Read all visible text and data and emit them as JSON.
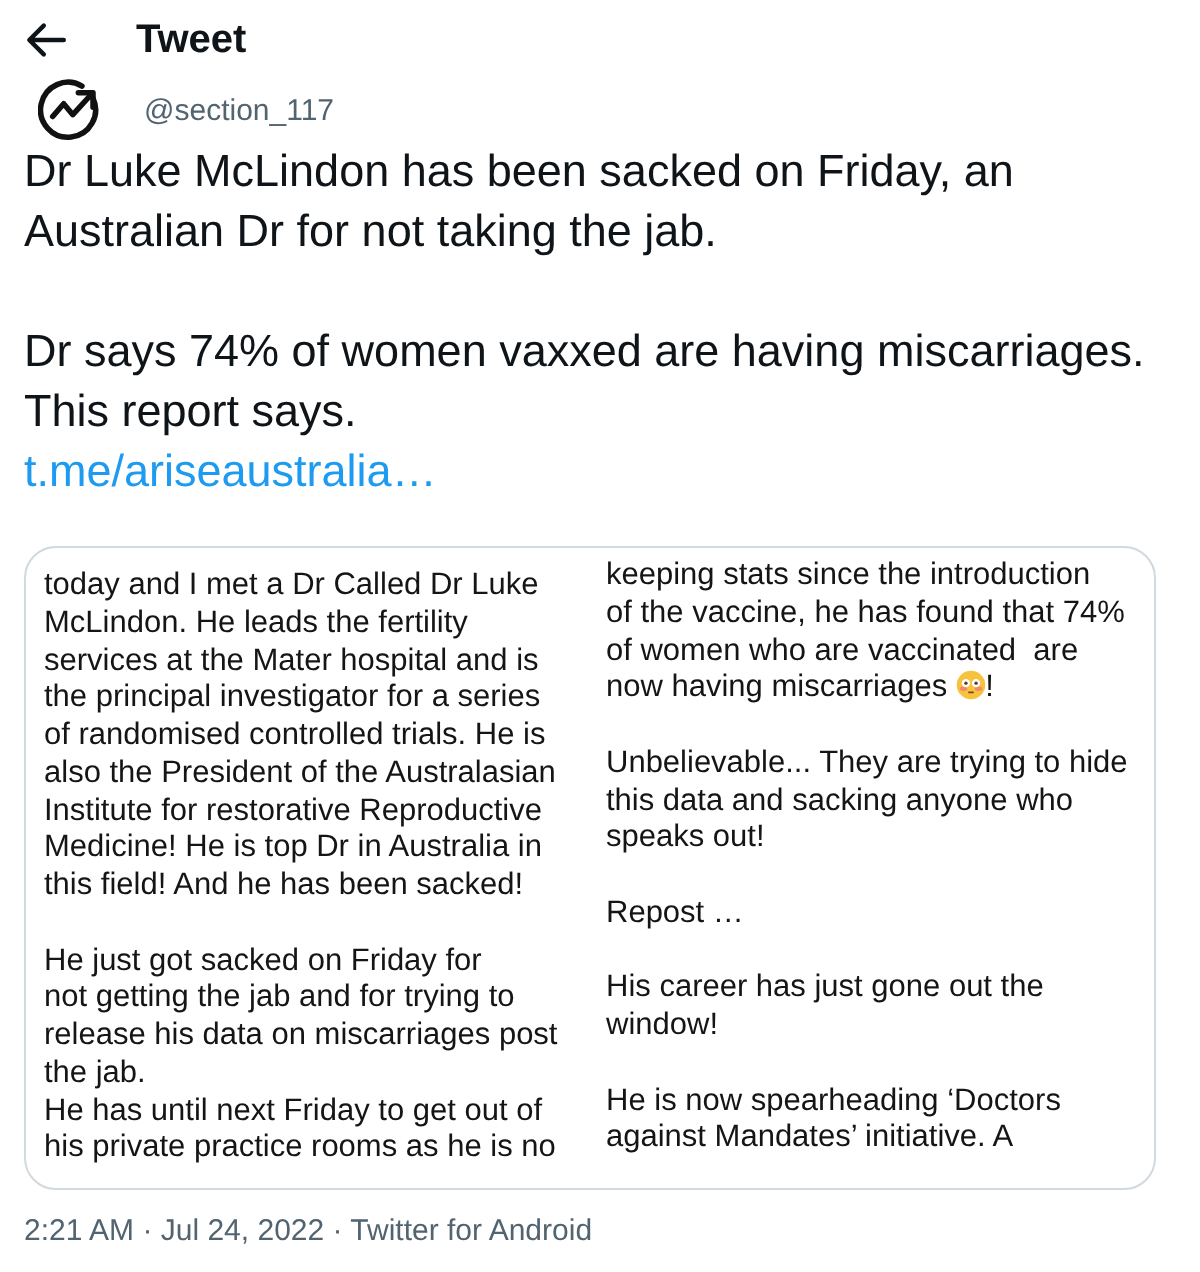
{
  "header": {
    "title": "Tweet"
  },
  "author": {
    "handle": "@section_117"
  },
  "tweet": {
    "paragraphs": [
      "Dr Luke McLindon has been sacked on Friday, an Australian Dr for not taking the jab.",
      "Dr says 74% of women vaxxed are having miscarriages.\nThis report says."
    ],
    "link": "t.me/ariseaustralia…"
  },
  "media": {
    "columns": [
      {
        "paragraphs": [
          {
            "parts": [
              {
                "kind": "block",
                "text": "today and I met a Dr Called Dr Luke\nMcLindon. He leads the fertility\nservices at the Mater hospital and is\nthe principal investigator for a series\nof randomised controlled trials. He is\nalso the President of the Australasian\nInstitute for restorative Reproductive\nMedicine! He is top Dr in Australia in\nthis field! And he has been sacked!"
              }
            ]
          },
          {
            "parts": [
              {
                "kind": "block",
                "text": "He just got sacked on Friday for\nnot getting the jab and for trying to\nrelease his data on miscarriages post\nthe jab.\nHe has until next Friday to get out of\nhis private practice rooms as he is no"
              }
            ]
          }
        ]
      },
      {
        "paragraphs": [
          {
            "parts": [
              {
                "kind": "block",
                "text": "keeping stats since the introduction\nof the vaccine, he has found that 74%\nof women who are vaccinated  are"
              },
              {
                "kind": "text",
                "text": "now having miscarriages"
              },
              {
                "kind": "emoji"
              },
              {
                "kind": "text",
                "text": "!"
              }
            ]
          },
          {
            "parts": [
              {
                "kind": "block",
                "text": "Unbelievable... They are trying to hide\nthis data and sacking anyone who\nspeaks out!"
              }
            ]
          },
          {
            "parts": [
              {
                "kind": "block",
                "text": "Repost …"
              }
            ]
          },
          {
            "parts": [
              {
                "kind": "block",
                "text": "His career has just gone out the\nwindow!"
              }
            ]
          },
          {
            "parts": [
              {
                "kind": "block",
                "text": "He is now spearheading ‘Doctors\nagainst Mandates’ initiative. A"
              }
            ]
          }
        ]
      }
    ]
  },
  "meta": {
    "timestamp": "2:21 AM · Jul 24, 2022 · Twitter for Android"
  }
}
